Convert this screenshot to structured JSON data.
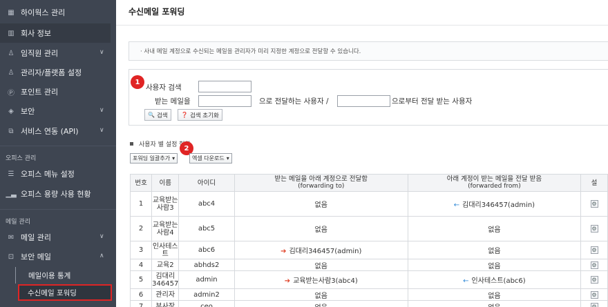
{
  "sidebar": {
    "items": [
      {
        "label": "하이웍스 관리",
        "icon": "grid-icon",
        "chevron": false
      },
      {
        "label": "회사 정보",
        "icon": "building-icon",
        "chevron": false
      },
      {
        "label": "임직원 관리",
        "icon": "user-icon",
        "chevron": true
      },
      {
        "label": "관리자/플랫폼 설정",
        "icon": "admin-user-icon",
        "chevron": false
      },
      {
        "label": "포인트 관리",
        "icon": "point-icon",
        "chevron": false
      },
      {
        "label": "보안",
        "icon": "shield-icon",
        "chevron": true
      },
      {
        "label": "서비스 연동 (API)",
        "icon": "api-icon",
        "chevron": true
      }
    ],
    "office_section": "오피스 관리",
    "office_items": [
      {
        "label": "오피스 메뉴 설정",
        "icon": "list-icon"
      },
      {
        "label": "오피스 용량 사용 현황",
        "icon": "bar-chart-icon"
      }
    ],
    "mail_section": "메일 관리",
    "mail_items": [
      {
        "label": "메일 관리",
        "icon": "mail-icon",
        "chevron": "down"
      },
      {
        "label": "보안 메일",
        "icon": "secure-mail-icon",
        "chevron": "up"
      }
    ],
    "sub_items": [
      "메일이용 통계",
      "수신메일 포워딩"
    ]
  },
  "page": {
    "title": "수신메일 포워딩",
    "notice": "· 사내 메일 계정으로 수신되는 메일을 관리자가 미리 지정한 계정으로 전달할 수 있습니다."
  },
  "search": {
    "badge1": "1",
    "user_search_label": "사용자 검색",
    "receive_label": "받는 메일을",
    "forward_to_label": "으로 전달하는 사용자 /",
    "forward_from_label": "으로부터 전달 받는 사용자",
    "search_button": "검색",
    "reset_button": "검색 초기화"
  },
  "section": {
    "title": "사용자 별 설정 현황",
    "badge2": "2",
    "bulk_add_button": "포워딩 일괄추가",
    "excel_button": "엑셀 다운로드"
  },
  "table": {
    "headers": {
      "no": "번호",
      "name": "이름",
      "id": "아이디",
      "to_main": "받는 메일을 아래 계정으로 전달함",
      "to_sub": "(forwarding to)",
      "from_main": "아래 계정이 받는 메일을 전달 받음",
      "from_sub": "(forwarded from)",
      "setting": "설"
    },
    "rows": [
      {
        "no": "1",
        "name": "교육받는사람3",
        "id": "abc4",
        "to": "없음",
        "to_arrow": false,
        "from": "김대리346457(admin)",
        "from_arrow": true
      },
      {
        "no": "2",
        "name": "교육받는사람4",
        "id": "abc5",
        "to": "없음",
        "to_arrow": false,
        "from": "없음",
        "from_arrow": false
      },
      {
        "no": "3",
        "name": "인사테스트",
        "id": "abc6",
        "to": "김대리346457(admin)",
        "to_arrow": true,
        "from": "없음",
        "from_arrow": false
      },
      {
        "no": "4",
        "name": "교육2",
        "id": "abhds2",
        "to": "없음",
        "to_arrow": false,
        "from": "없음",
        "from_arrow": false
      },
      {
        "no": "5",
        "name": "김대리346457",
        "id": "admin",
        "to": "교육받는사람3(abc4)",
        "to_arrow": true,
        "from": "인사테스트(abc6)",
        "from_arrow": true
      },
      {
        "no": "6",
        "name": "관리자",
        "id": "admin2",
        "to": "없음",
        "to_arrow": false,
        "from": "없음",
        "from_arrow": false
      },
      {
        "no": "7",
        "name": "부사장",
        "id": "ceo",
        "to": "없음",
        "to_arrow": false,
        "from": "없음",
        "from_arrow": false
      }
    ]
  },
  "colors": {
    "sidebar_bg": "#3e4551",
    "highlight": "#e02424",
    "arrow_to": "#e0442a",
    "arrow_from": "#2a86d6"
  }
}
